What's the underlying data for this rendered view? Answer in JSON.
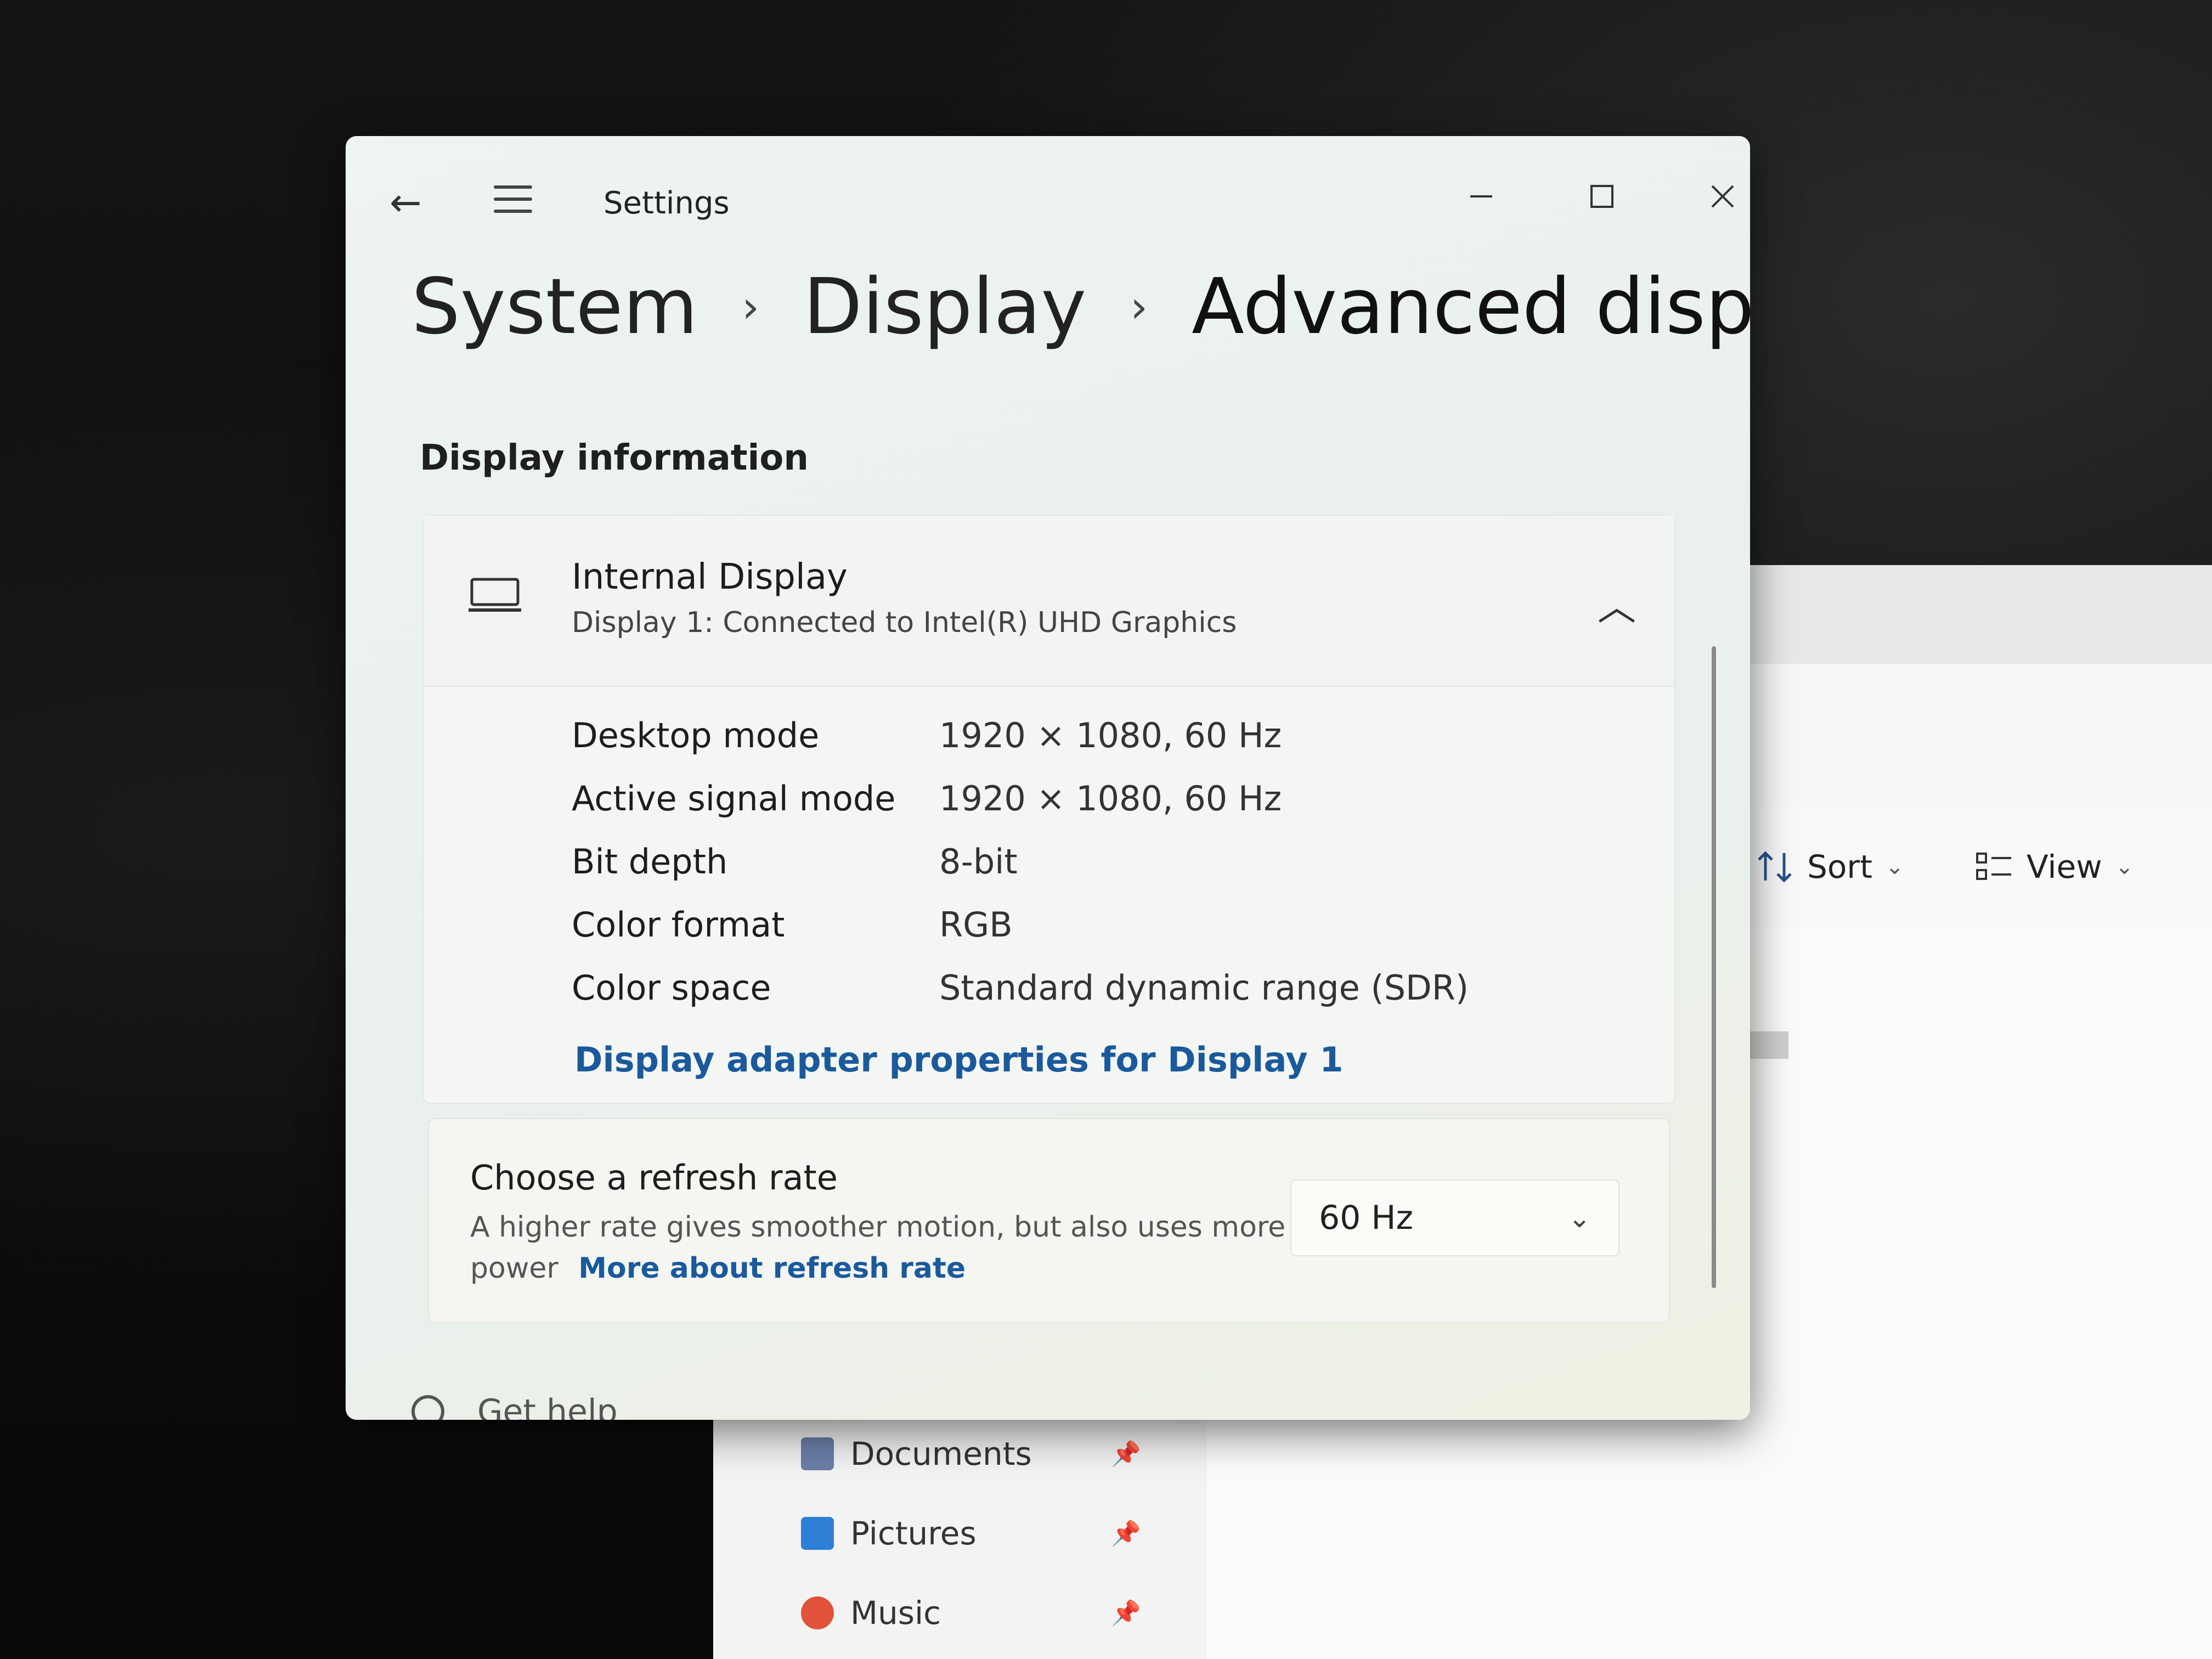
{
  "settings": {
    "app_title": "Settings",
    "breadcrumb": [
      "System",
      "Display",
      "Advanced display"
    ],
    "section_title": "Display information",
    "display": {
      "name": "Internal Display",
      "subtitle": "Display 1: Connected to Intel(R) UHD Graphics",
      "rows": [
        {
          "key": "Desktop mode",
          "value": "1920 × 1080, 60 Hz"
        },
        {
          "key": "Active signal mode",
          "value": "1920 × 1080, 60 Hz"
        },
        {
          "key": "Bit depth",
          "value": "8-bit"
        },
        {
          "key": "Color format",
          "value": "RGB"
        },
        {
          "key": "Color space",
          "value": "Standard dynamic range (SDR)"
        }
      ],
      "adapter_link": "Display adapter properties for Display 1"
    },
    "refresh": {
      "title": "Choose a refresh rate",
      "description": "A higher rate gives smoother motion, but also uses more power",
      "link": "More about refresh rate",
      "selected": "60 Hz"
    },
    "get_help": "Get help"
  },
  "explorer": {
    "toolbar": {
      "sort_label": "Sort",
      "view_label": "View"
    },
    "nav": [
      {
        "label": "Documents",
        "icon": "documents-folder-icon",
        "color": "#6b7fa8"
      },
      {
        "label": "Pictures",
        "icon": "pictures-folder-icon",
        "color": "#2e7fd6"
      },
      {
        "label": "Music",
        "icon": "music-folder-icon",
        "color": "#e0533a"
      }
    ]
  },
  "colors": {
    "link": "#1a5a9c",
    "settings_bg": "#eef3f3"
  }
}
